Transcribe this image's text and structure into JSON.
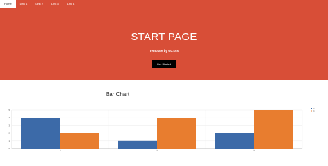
{
  "nav": {
    "items": [
      {
        "label": "Home",
        "active": true
      },
      {
        "label": "Link 1",
        "active": false
      },
      {
        "label": "Link 2",
        "active": false
      },
      {
        "label": "Link 3",
        "active": false
      },
      {
        "label": "Link 4",
        "active": false
      }
    ]
  },
  "hero": {
    "title": "START PAGE",
    "subtitle": "Template by w3.css",
    "button_label": "Get Started"
  },
  "colors": {
    "accent": "#d84e37",
    "series_a": "#3c6aa8",
    "series_b": "#e87d2f"
  },
  "chart_data": {
    "type": "bar",
    "title": "Bar Chart",
    "categories": [
      "1",
      "2",
      "3"
    ],
    "series": [
      {
        "name": "A",
        "values": [
          4,
          1,
          2
        ]
      },
      {
        "name": "B",
        "values": [
          2,
          4,
          5
        ]
      }
    ],
    "ylim": [
      0,
      5
    ],
    "yticks": [
      0,
      1,
      2,
      3,
      4,
      5
    ],
    "grid": true,
    "legend": "right"
  }
}
